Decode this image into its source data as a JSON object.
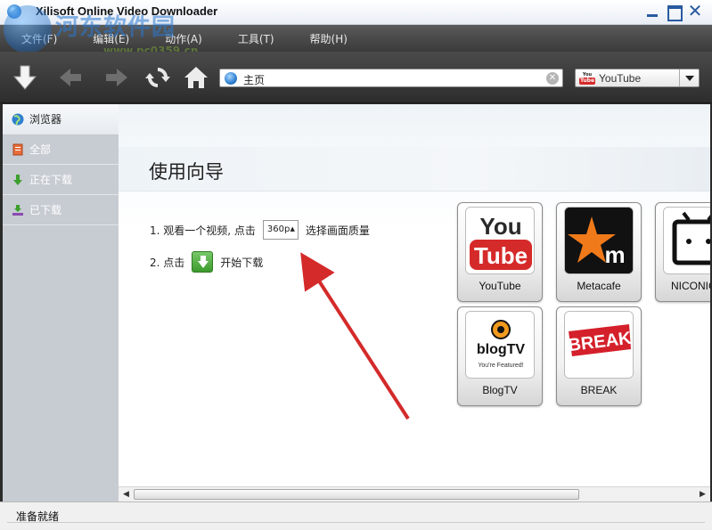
{
  "window": {
    "title": "Xilisoft Online Video Downloader",
    "watermark_text": "河东软件园",
    "watermark_url": "www.pc0359.cn"
  },
  "menu": {
    "items": [
      {
        "label": "文件(F)"
      },
      {
        "label": "编辑(E)"
      },
      {
        "label": "动作(A)"
      },
      {
        "label": "工具(T)"
      },
      {
        "label": "帮助(H)"
      }
    ]
  },
  "address_bar": {
    "value": "主页"
  },
  "site_selector": {
    "selected": "YouTube",
    "mini_logo_top": "You",
    "mini_logo_bottom": "Tube"
  },
  "sidebar": {
    "items": [
      {
        "label": "浏览器"
      },
      {
        "label": "全部"
      },
      {
        "label": "正在下载"
      },
      {
        "label": "已下载"
      }
    ]
  },
  "guide": {
    "title": "使用向导",
    "step1_prefix": "1. 观看一个视频, 点击",
    "step1_quality": "360p",
    "step1_suffix": "选择画面质量",
    "step2_prefix": "2. 点击",
    "step2_suffix": "开始下载"
  },
  "sites": {
    "youtube": {
      "label": "YouTube",
      "logo_top": "You",
      "logo_bottom": "Tube"
    },
    "metacafe": {
      "label": "Metacafe"
    },
    "niconico": {
      "label": "NICONICO"
    },
    "blogtv": {
      "label": "BlogTV",
      "logo_text": "blogTV",
      "logo_sub": "You're Featured!"
    },
    "break": {
      "label": "BREAK",
      "logo_text": "BREAK"
    }
  },
  "status": {
    "text": "准备就绪"
  },
  "colors": {
    "toolbar_bg": "#3a3a3a",
    "sidebar_bg": "#c7cbd2",
    "youtube_red": "#d52a2a",
    "annotation_arrow": "#d42a2a"
  }
}
